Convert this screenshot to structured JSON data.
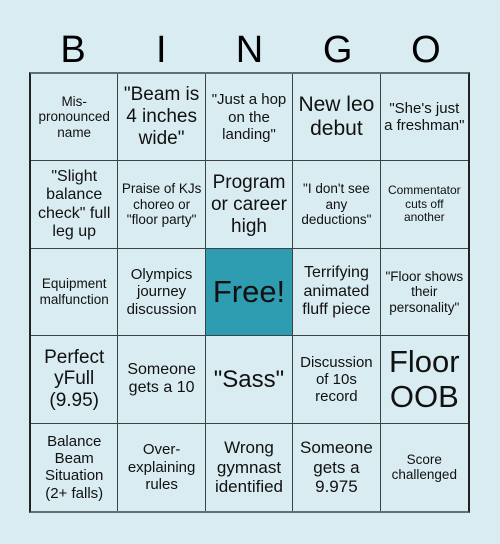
{
  "header": {
    "letters": [
      "B",
      "I",
      "N",
      "G",
      "O"
    ]
  },
  "colors": {
    "background": "#d9ecf1",
    "free_cell": "#2f9db1"
  },
  "cells": [
    "Mis-pronounced name",
    "\"Beam is 4 inches wide\"",
    "\"Just a hop on the landing\"",
    "New leo debut",
    "\"She's just a freshman\"",
    "\"Slight balance check\" full leg up",
    "Praise of KJs choreo or \"floor party\"",
    "Program or career high",
    "\"I don't see any deductions\"",
    "Commentator cuts off another",
    "Equipment malfunction",
    "Olympics journey discussion",
    "Free!",
    "Terrifying animated fluff piece",
    "\"Floor shows their personality\"",
    "Perfect yFull (9.95)",
    "Someone gets a 10",
    "\"Sass\"",
    "Discussion of 10s record",
    "Floor OOB",
    "Balance Beam Situation (2+ falls)",
    "Over-explaining rules",
    "Wrong gymnast identified",
    "Someone gets a 9.975",
    "Score challenged"
  ]
}
